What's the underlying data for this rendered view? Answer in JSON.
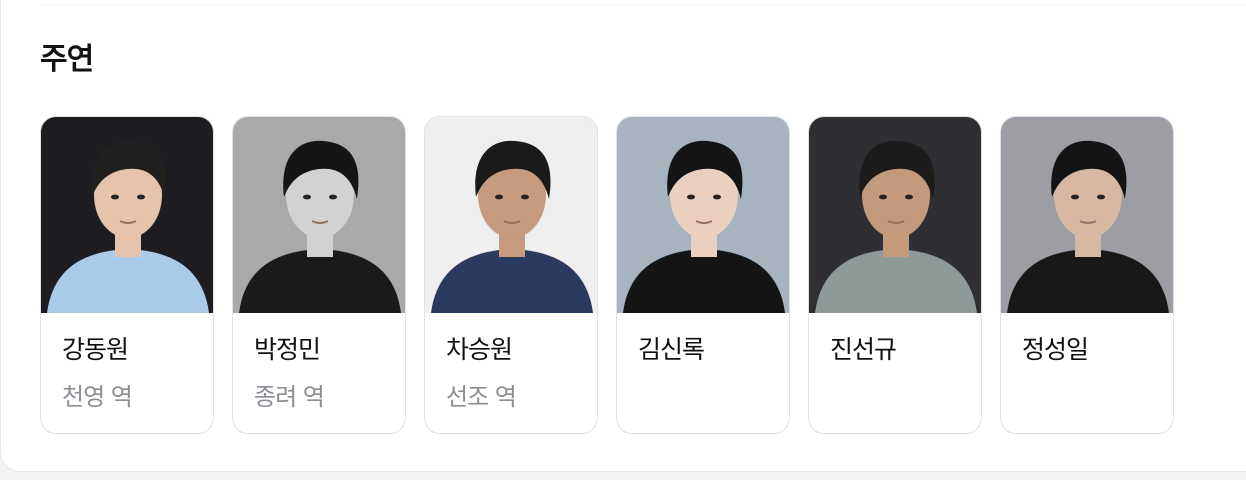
{
  "section": {
    "title": "주연"
  },
  "cast": [
    {
      "name": "강동원",
      "role": "천영 역",
      "photo_bg": "#1c1c21",
      "shirt": "#a9cbe8",
      "tone": "#e6c3ac",
      "hair": "#22201e"
    },
    {
      "name": "박정민",
      "role": "종려 역",
      "photo_bg": "#a9a9a9",
      "shirt": "#1a1a1a",
      "tone": "#d2d2d2",
      "hair": "#151515"
    },
    {
      "name": "차승원",
      "role": "선조 역",
      "photo_bg": "#efefef",
      "shirt": "#2b3a5f",
      "tone": "#c79b80",
      "hair": "#1a1a1a"
    },
    {
      "name": "김신록",
      "role": "",
      "photo_bg": "#a7b3bf",
      "shirt": "#151515",
      "tone": "#ebd0c0",
      "hair": "#141414"
    },
    {
      "name": "진선규",
      "role": "",
      "photo_bg": "#2f2f33",
      "shirt": "#8d9a98",
      "tone": "#c49a7c",
      "hair": "#1d1b1a"
    },
    {
      "name": "정성일",
      "role": "",
      "photo_bg": "#9c9ea3",
      "shirt": "#181818",
      "tone": "#d7b9a3",
      "hair": "#141414"
    }
  ]
}
